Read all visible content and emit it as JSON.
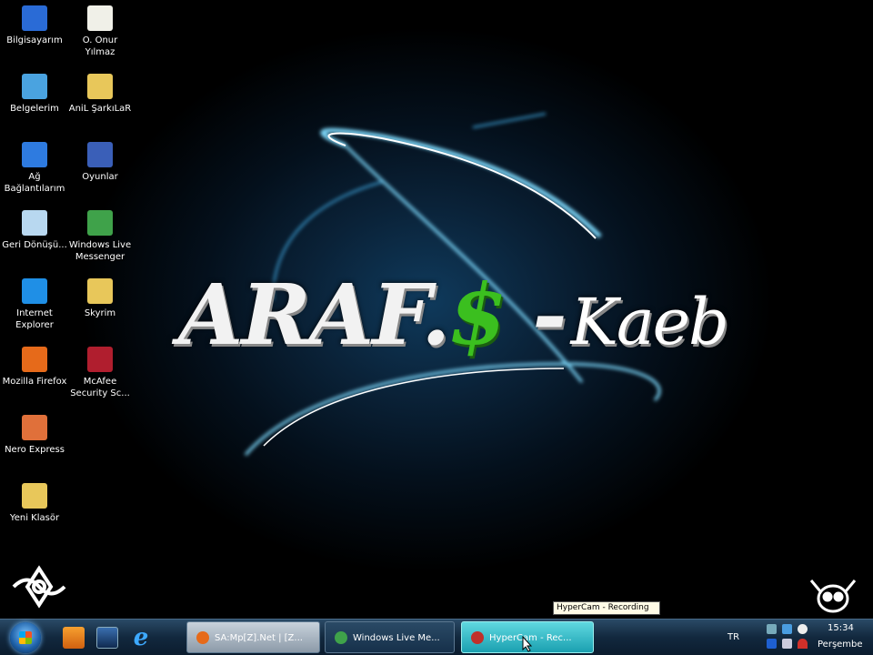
{
  "wallpaper": {
    "logo_main": "ARAF.",
    "logo_dollar": "$",
    "logo_dash": "-",
    "logo_signature": "Kaeb"
  },
  "desktop_icons": [
    {
      "label": "Bilgisayarım",
      "icon": "computer-icon",
      "color": "#2a6bd6"
    },
    {
      "label": "O. Onur Yılmaz",
      "icon": "document-icon",
      "color": "#f0f0e8"
    },
    {
      "label": "Belgelerim",
      "icon": "documents-icon",
      "color": "#4aa3e0"
    },
    {
      "label": "AniL ŞarkıLaR",
      "icon": "folder-icon",
      "color": "#e8c75a"
    },
    {
      "label": "Ağ Bağlantılarım",
      "icon": "network-icon",
      "color": "#2e7be0"
    },
    {
      "label": "Oyunlar",
      "icon": "games-icon",
      "color": "#3a5fb8"
    },
    {
      "label": "Geri Dönüşü...",
      "icon": "recycle-bin-icon",
      "color": "#b8d8f0"
    },
    {
      "label": "Windows Live Messenger",
      "icon": "messenger-icon",
      "color": "#3fa24a"
    },
    {
      "label": "Internet Explorer",
      "icon": "internet-explorer-icon",
      "color": "#1f8fe6"
    },
    {
      "label": "Skyrim",
      "icon": "folder-icon",
      "color": "#e8c75a"
    },
    {
      "label": "Mozilla Firefox",
      "icon": "firefox-icon",
      "color": "#e66a1a"
    },
    {
      "label": "McAfee Security Sc...",
      "icon": "mcafee-icon",
      "color": "#b01e2e"
    },
    {
      "label": "Nero Express",
      "icon": "nero-icon",
      "color": "#e0703a"
    },
    {
      "label": "Yeni Klasör",
      "icon": "folder-icon",
      "color": "#e8c75a"
    }
  ],
  "taskbar": {
    "tasks": [
      {
        "label": "SA:Mp[Z].Net | [Z...",
        "icon": "firefox-icon"
      },
      {
        "label": "Windows Live Me...",
        "icon": "messenger-icon"
      },
      {
        "label": "HyperCam - Rec...",
        "icon": "hypercam-icon"
      }
    ],
    "tooltip": "HyperCam - Recording",
    "language": "TR",
    "time": "15:34",
    "day": "Perşembe"
  }
}
